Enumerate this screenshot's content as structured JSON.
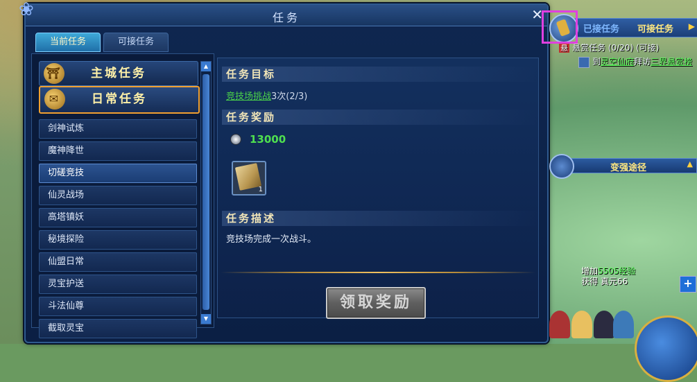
{
  "dialog": {
    "title": "任务"
  },
  "tabs": [
    {
      "label": "当前任务",
      "active": true
    },
    {
      "label": "可接任务",
      "active": false
    }
  ],
  "categories": {
    "main": "主城任务",
    "daily": "日常任务"
  },
  "daily_list": [
    "剑神试炼",
    "魔神降世",
    "切磋竞技",
    "仙灵战场",
    "高塔镇妖",
    "秘境探险",
    "仙盟日常",
    "灵宝护送",
    "斗法仙尊",
    "截取灵宝"
  ],
  "selected_index": 2,
  "detail": {
    "goal_heading": "任务目标",
    "goal_link": "竞技场挑战",
    "goal_suffix": "3次",
    "goal_progress": "(2/3)",
    "reward_heading": "任务奖励",
    "reward_money": "13000",
    "reward_item_count": "1",
    "desc_heading": "任务描述",
    "desc_text": "竞技场完成一次战斗。",
    "claim_button": "领取奖励"
  },
  "hud": {
    "tab_accepted": "已接任务",
    "tab_available": "可接任务",
    "bounty_tag": "悬",
    "bounty_text": "悬赏任务 (0/20) (可接)",
    "visit_prefix": "到",
    "visit_place": "灵空仙府",
    "visit_mid": "拜访",
    "visit_target": "三界悬赏榜",
    "strong_label": "变强途径",
    "exp_line1_prefix": "增加",
    "exp_line1_value": "5505经验",
    "exp_line2": "获得 真元66"
  },
  "colors": {
    "accent_gold": "#f0a030",
    "link_green": "#4ad24a",
    "highlight_magenta": "#e040e0"
  }
}
